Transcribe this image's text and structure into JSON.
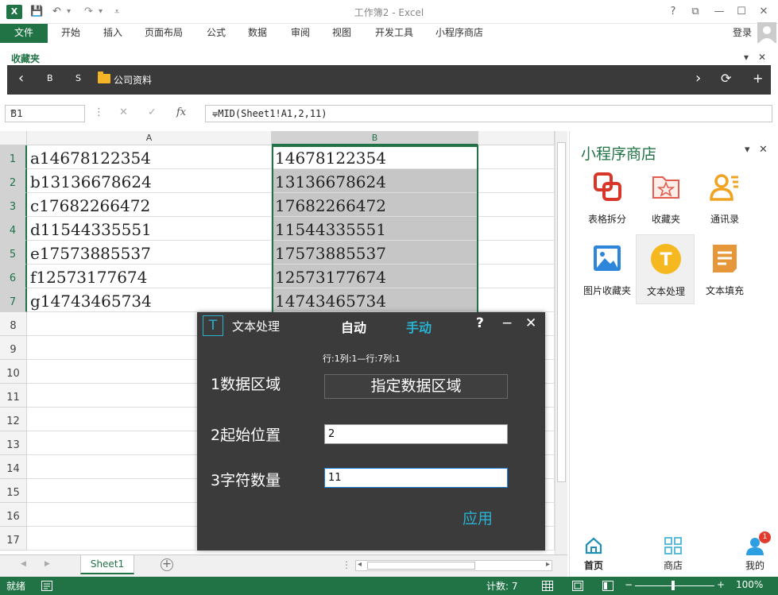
{
  "app": {
    "doc_title": "工作簿2 - Excel",
    "logo_text": "X",
    "quick_access": {
      "save": "💾",
      "undo": "↶",
      "undo_dd": "▾",
      "redo": "↷",
      "redo_dd": "▾",
      "customize": "⩡"
    },
    "window_buttons": {
      "help": "?",
      "ribbon_options": "⧉",
      "minimize": "—",
      "maximize": "☐",
      "close": "✕"
    }
  },
  "ribbon": {
    "file_tab": "文件",
    "tabs": [
      "开始",
      "插入",
      "页面布局",
      "公式",
      "数据",
      "审阅",
      "视图",
      "开发工具",
      "小程序商店"
    ],
    "login": "登录"
  },
  "favorites": {
    "label": "收藏夹",
    "ctrl_dropdown": "▾",
    "ctrl_close": "✕",
    "back": "‹",
    "b_label": "B",
    "s_label": "S",
    "folder": "公司资料",
    "forward": "›",
    "refresh": "⟳",
    "add": "+"
  },
  "formula_bar": {
    "name_box": "B1",
    "name_dd": "▾",
    "dots": "⋮",
    "cancel": "✕",
    "enter": "✓",
    "fx": "fx",
    "formula": "=MID(Sheet1!A1,2,11)",
    "expand": "⌄"
  },
  "grid": {
    "columns": [
      "A",
      "B"
    ],
    "rows": [
      "1",
      "2",
      "3",
      "4",
      "5",
      "6",
      "7",
      "8",
      "9",
      "10",
      "11",
      "12",
      "13",
      "14",
      "15",
      "16",
      "17"
    ],
    "col_a": [
      "a14678122354",
      "b13136678624",
      "c17682266472",
      "d11544335551",
      "e17573885537",
      "f12573177674",
      "g14743465734"
    ],
    "col_b": [
      "14678122354",
      "13136678624",
      "17682266472",
      "11544335551",
      "17573885537",
      "12573177674",
      "14743465734"
    ]
  },
  "sheets": {
    "active": "Sheet1",
    "add": "+",
    "nav_prev": "◀",
    "nav_next": "▶",
    "dots": "⋮",
    "hs_left": "◂",
    "hs_right": "▸"
  },
  "status": {
    "ready": "就绪",
    "count": "计数: 7",
    "zoom_minus": "−",
    "zoom_plus": "+",
    "zoom": "100%"
  },
  "pane": {
    "title": "小程序商店",
    "dd": "▾",
    "close": "✕",
    "apps": [
      {
        "label": "表格拆分",
        "icon": "table-split-icon",
        "color": "#d9362a"
      },
      {
        "label": "收藏夹",
        "icon": "favorites-folder-icon",
        "color": "#e25d4e"
      },
      {
        "label": "通讯录",
        "icon": "contacts-icon",
        "color": "#f0a221"
      },
      {
        "label": "图片收藏夹",
        "icon": "image-favorites-icon",
        "color": "#2d86d9"
      },
      {
        "label": "文本处理",
        "icon": "text-processing-icon",
        "color": "#f6b81f"
      },
      {
        "label": "文本填充",
        "icon": "text-fill-icon",
        "color": "#e5973a"
      }
    ],
    "nav": [
      {
        "label": "首页",
        "icon": "home-icon",
        "color": "#1f8fb5"
      },
      {
        "label": "商店",
        "icon": "store-icon",
        "color": "#4ab6d6"
      },
      {
        "label": "我的",
        "icon": "user-icon",
        "color": "#2d9fe0"
      }
    ],
    "badge": "1"
  },
  "dialog": {
    "logo": "T",
    "title": "文本处理",
    "auto": "自动",
    "manual": "手动",
    "help": "?",
    "minimize": "−",
    "close": "✕",
    "info": "行:1列:1—行:7列:1",
    "label_region": "1数据区域",
    "region_button": "指定数据区域",
    "label_start": "2起始位置",
    "start_value": "2",
    "label_count": "3字符数量",
    "count_value": "11",
    "apply": "应用",
    "accent": "#29b2d1"
  }
}
